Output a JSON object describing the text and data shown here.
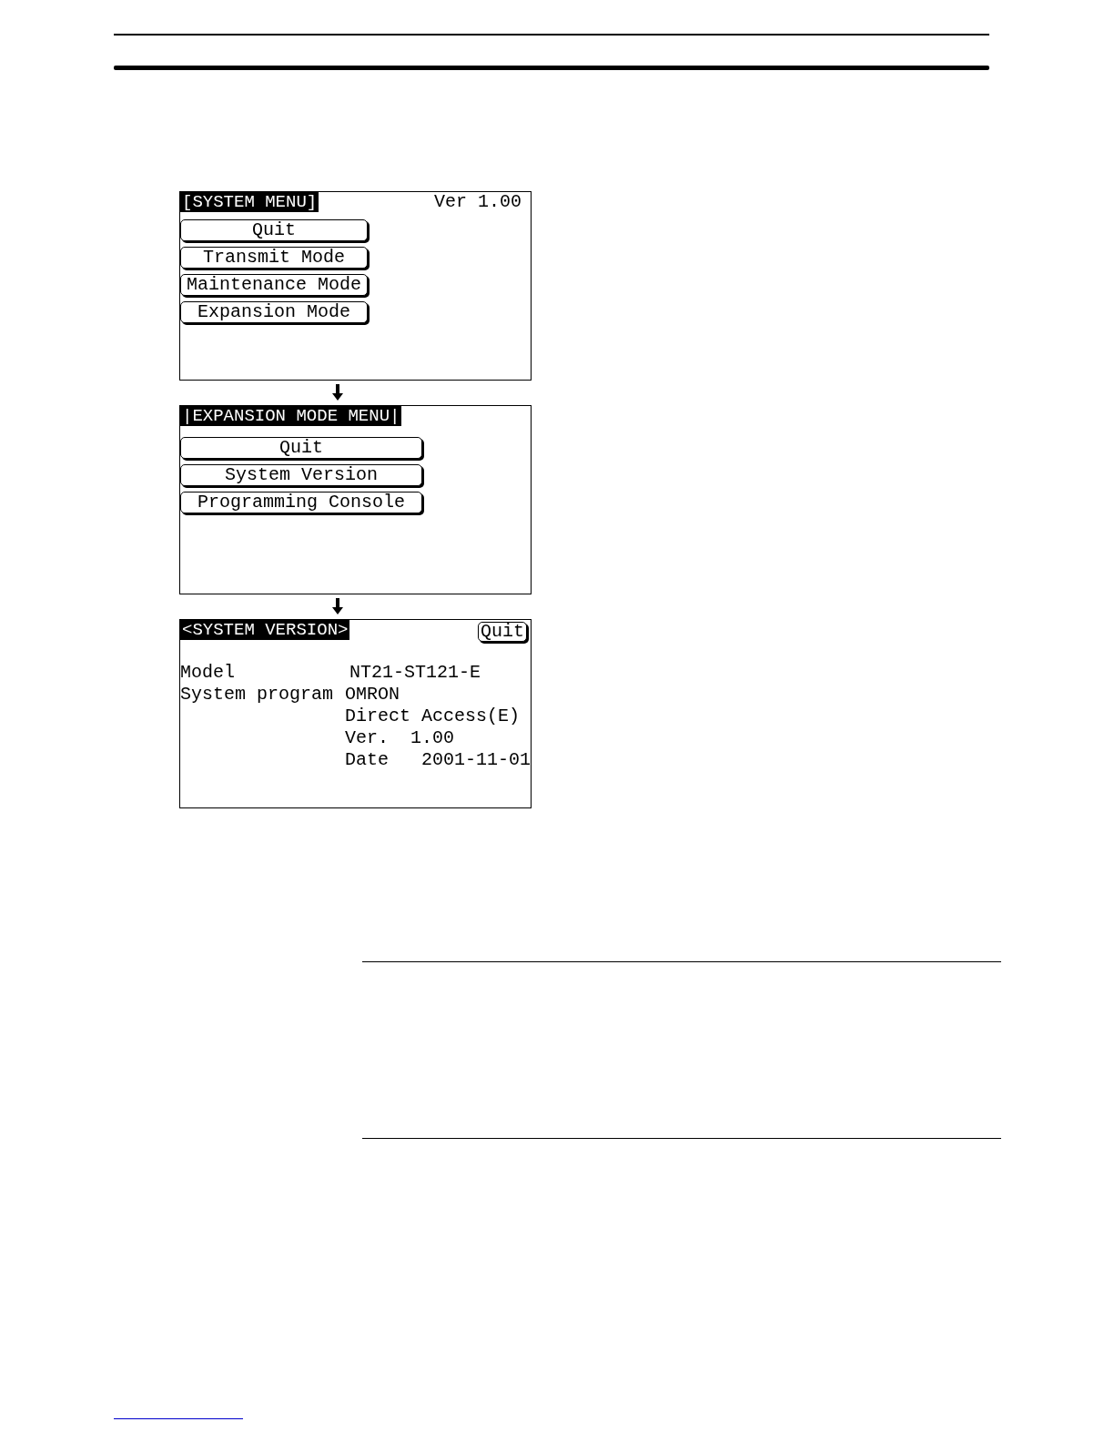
{
  "screens": [
    {
      "kind": "menu",
      "title": "[SYSTEM MENU]",
      "version": "Ver 1.00",
      "buttons": [
        "Quit",
        "Transmit Mode",
        "Maintenance Mode",
        "Expansion Mode"
      ]
    },
    {
      "kind": "menu",
      "title": "|EXPANSION MODE MENU|",
      "buttons": [
        "Quit",
        "System Version",
        "Programming Console"
      ]
    },
    {
      "kind": "info",
      "title": "<SYSTEM VERSION>",
      "quit": "Quit",
      "rows": [
        {
          "label": "Model",
          "values": [
            "NT21-ST121-E"
          ]
        },
        {
          "label": "System program",
          "values": [
            "OMRON",
            "Direct Access(E)",
            "Ver.  1.00",
            "Date   2001-11-01"
          ]
        }
      ]
    }
  ]
}
